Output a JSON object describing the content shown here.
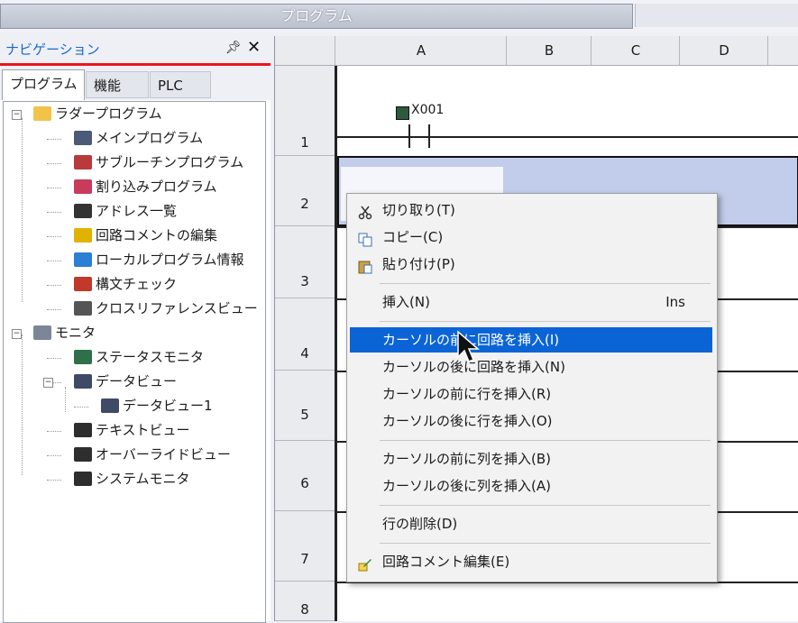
{
  "window": {
    "title": "プログラム"
  },
  "nav": {
    "title": "ナビゲーション",
    "pin_icon": "pin-icon",
    "close_icon": "close-icon",
    "tabs": [
      "プログラム",
      "機能",
      "PLC"
    ],
    "tree": [
      {
        "label": "ラダープログラム",
        "icon": "folder-open-icon",
        "level": 0,
        "expanded": true
      },
      {
        "label": "メインプログラム",
        "icon": "main-program-icon",
        "level": 1
      },
      {
        "label": "サブルーチンプログラム",
        "icon": "subroutine-icon",
        "level": 1
      },
      {
        "label": "割り込みプログラム",
        "icon": "interrupt-icon",
        "level": 1
      },
      {
        "label": "アドレス一覧",
        "icon": "address-list-icon",
        "level": 1
      },
      {
        "label": "回路コメントの編集",
        "icon": "edit-comment-icon",
        "level": 1
      },
      {
        "label": "ローカルプログラム情報",
        "icon": "local-info-icon",
        "level": 1
      },
      {
        "label": "構文チェック",
        "icon": "syntax-check-icon",
        "level": 1
      },
      {
        "label": "クロスリファレンスビュー",
        "icon": "cross-reference-icon",
        "level": 1
      },
      {
        "label": "モニタ",
        "icon": "monitor-icon",
        "level": 0,
        "expanded": true
      },
      {
        "label": "ステータスモニタ",
        "icon": "status-monitor-icon",
        "level": 1
      },
      {
        "label": "データビュー",
        "icon": "data-view-icon",
        "level": 1,
        "expanded": true
      },
      {
        "label": "データビュー1",
        "icon": "data-view-icon",
        "level": 2
      },
      {
        "label": "テキストビュー",
        "icon": "text-view-icon",
        "level": 1
      },
      {
        "label": "オーバーライドビュー",
        "icon": "override-view-icon",
        "level": 1
      },
      {
        "label": "システムモニタ",
        "icon": "system-monitor-icon",
        "level": 1
      }
    ]
  },
  "editor": {
    "columns": [
      "A",
      "B",
      "C",
      "D"
    ],
    "rows": [
      "1",
      "2",
      "3",
      "4",
      "5",
      "6",
      "7",
      "8"
    ],
    "contact_label": "X001"
  },
  "context_menu": {
    "items": [
      {
        "label": "切り取り(T)",
        "icon": "cut-icon"
      },
      {
        "label": "コピー(C)",
        "icon": "copy-icon"
      },
      {
        "label": "貼り付け(P)",
        "icon": "paste-icon"
      },
      {
        "separator": true
      },
      {
        "label": "挿入(N)",
        "shortcut": "Ins"
      },
      {
        "separator": true
      },
      {
        "label": "カーソルの前に回路を挿入(I)",
        "highlighted": true
      },
      {
        "label": "カーソルの後に回路を挿入(N)"
      },
      {
        "label": "カーソルの前に行を挿入(R)"
      },
      {
        "label": "カーソルの後に行を挿入(O)"
      },
      {
        "separator": true
      },
      {
        "label": "カーソルの前に列を挿入(B)"
      },
      {
        "label": "カーソルの後に列を挿入(A)"
      },
      {
        "separator": true
      },
      {
        "label": "行の削除(D)"
      },
      {
        "separator": true
      },
      {
        "label": "回路コメント編集(E)",
        "icon": "edit-comment-icon"
      }
    ]
  },
  "colors": {
    "accent": "#0a64d6",
    "nav_underline": "#e8161a",
    "selection": "#c2cdeb"
  }
}
